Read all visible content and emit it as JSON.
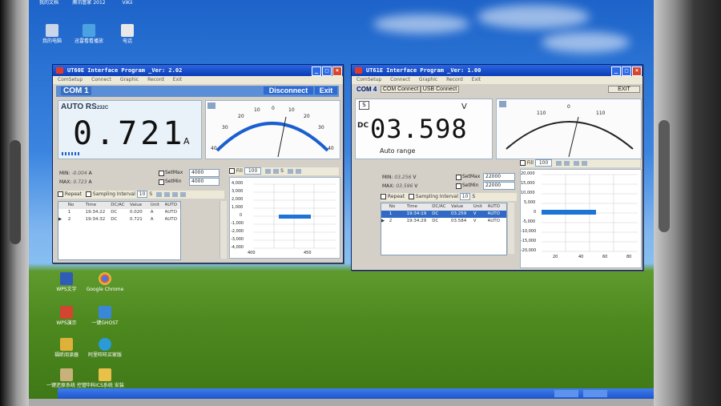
{
  "desktop": {
    "top_labels": [
      "我的文档",
      "腾讯管家 2012",
      "ViKii"
    ],
    "icons_left": [
      {
        "label": "我的电脑",
        "icon": "computer-icon"
      },
      {
        "label": "迅雷看看播放",
        "icon": "player-icon"
      },
      {
        "label": "电话",
        "icon": "phone-icon"
      }
    ],
    "icons_bottom": [
      {
        "label": "WPS文字",
        "icon": "wps-writer-icon"
      },
      {
        "label": "Google Chrome",
        "icon": "chrome-icon"
      },
      {
        "label": "WPS演示",
        "icon": "wps-present-icon"
      },
      {
        "label": "一键GHOST",
        "icon": "ghost-icon"
      },
      {
        "label": "福昕阅读器",
        "icon": "reader-icon"
      },
      {
        "label": "阿里旺旺买家版",
        "icon": "wangwang-icon"
      },
      {
        "label": "一键还原系统 控管",
        "icon": "restore-icon"
      },
      {
        "label": "华科ICS系统 安装启",
        "icon": "ics-icon"
      }
    ],
    "taskbar_items": [
      "",
      ""
    ]
  },
  "window1": {
    "title": "UT60E Interface Program _Ver: 2.02",
    "menu": [
      "ComSetup",
      "Connect",
      "Graphic",
      "Record",
      "Exit"
    ],
    "com_label": "COM 1",
    "disconnect_label": "Disconnect",
    "exit_label": "Exit",
    "mode_label": "AUTO RS",
    "mode_suffix": "232C",
    "reading": "0.721",
    "unit": "A",
    "gauge_ticks": [
      "40",
      "30",
      "20",
      "10",
      "0",
      "10",
      "20",
      "30",
      "40"
    ],
    "min_label": "MIN:",
    "min_value": "-0.004",
    "min_unit": "A",
    "max_label": "MAX:",
    "max_value": "0.723",
    "max_unit": "A",
    "setmax_label": "SetMax",
    "setmax_value": "4000",
    "setmin_label": "SetMin",
    "setmin_value": "4000",
    "repeat_label": "Repeat",
    "sampling_label": "Sampling Interval",
    "sampling_value": "10",
    "sampling_unit": "S",
    "chart_toolbar_fill": "Fill",
    "chart_toolbar_value": "100",
    "chart_toolbar_s": "S",
    "table_headers": [
      "No",
      "Time",
      "DC/AC",
      "Value",
      "Unit",
      "AUTO"
    ],
    "table_rows": [
      {
        "no": "1",
        "time": "19:34:22",
        "dcac": "DC",
        "value": "0.020",
        "unit": "A",
        "auto": "AUTO"
      },
      {
        "no": "2",
        "time": "19:34:32",
        "dcac": "DC",
        "value": "0.721",
        "unit": "A",
        "auto": "AUTO"
      }
    ],
    "chart_y_ticks": [
      "4,000",
      "3,000",
      "2,000",
      "1,000",
      "0",
      "-1,000",
      "-2,000",
      "-3,000",
      "-4,000"
    ],
    "chart_x_ticks": [
      "400",
      "450"
    ]
  },
  "window2": {
    "title": "UT61E Interface Program _Ver: 1.00",
    "menu": [
      "ComSetup",
      "Connect",
      "Graphic",
      "Record",
      "Exit"
    ],
    "com_label": "COM 4",
    "com_connect_label": "COM Connect",
    "usb_connect_label": "USB Connect",
    "exit_label": "EXIT",
    "s_label": "S",
    "unit": "V",
    "dc_label": "DC",
    "reading": "03.598",
    "range_label": "Auto range",
    "gauge_ticks": [
      "110",
      "0",
      "110"
    ],
    "min_label": "MIN:",
    "min_value": "03.256",
    "min_unit": "V",
    "max_label": "MAX:",
    "max_value": "03.596",
    "max_unit": "V",
    "setmax_label": "SetMax",
    "setmax_value": "22000",
    "setmin_label": "SetMin",
    "setmin_value": "22000",
    "repeat_label": "Repeat",
    "sampling_label": "Sampling Interval",
    "sampling_value": "10",
    "sampling_unit": "S",
    "chart_toolbar_fill": "Fill",
    "chart_toolbar_value": "100",
    "table_headers": [
      "No",
      "Time",
      "DC/AC",
      "Value",
      "Unit",
      "AUTO"
    ],
    "table_rows": [
      {
        "no": "1",
        "time": "19:34:19",
        "dcac": "DC",
        "value": "03.259",
        "unit": "V",
        "auto": "AUTO"
      },
      {
        "no": "2",
        "time": "19:34:29",
        "dcac": "DC",
        "value": "03.584",
        "unit": "V",
        "auto": "AUTO"
      }
    ],
    "chart_y_ticks": [
      "20,000",
      "15,000",
      "10,000",
      "5,000",
      "0",
      "-5,000",
      "-10,000",
      "-15,000",
      "-20,000"
    ],
    "chart_x_ticks": [
      "20",
      "40",
      "60",
      "80"
    ]
  },
  "colors": {
    "titlebar": "#0a3cb6",
    "accent_bar": "#5a8ed6",
    "trace": "#1e74d6",
    "gauge_arc": "#1a5fd0"
  }
}
